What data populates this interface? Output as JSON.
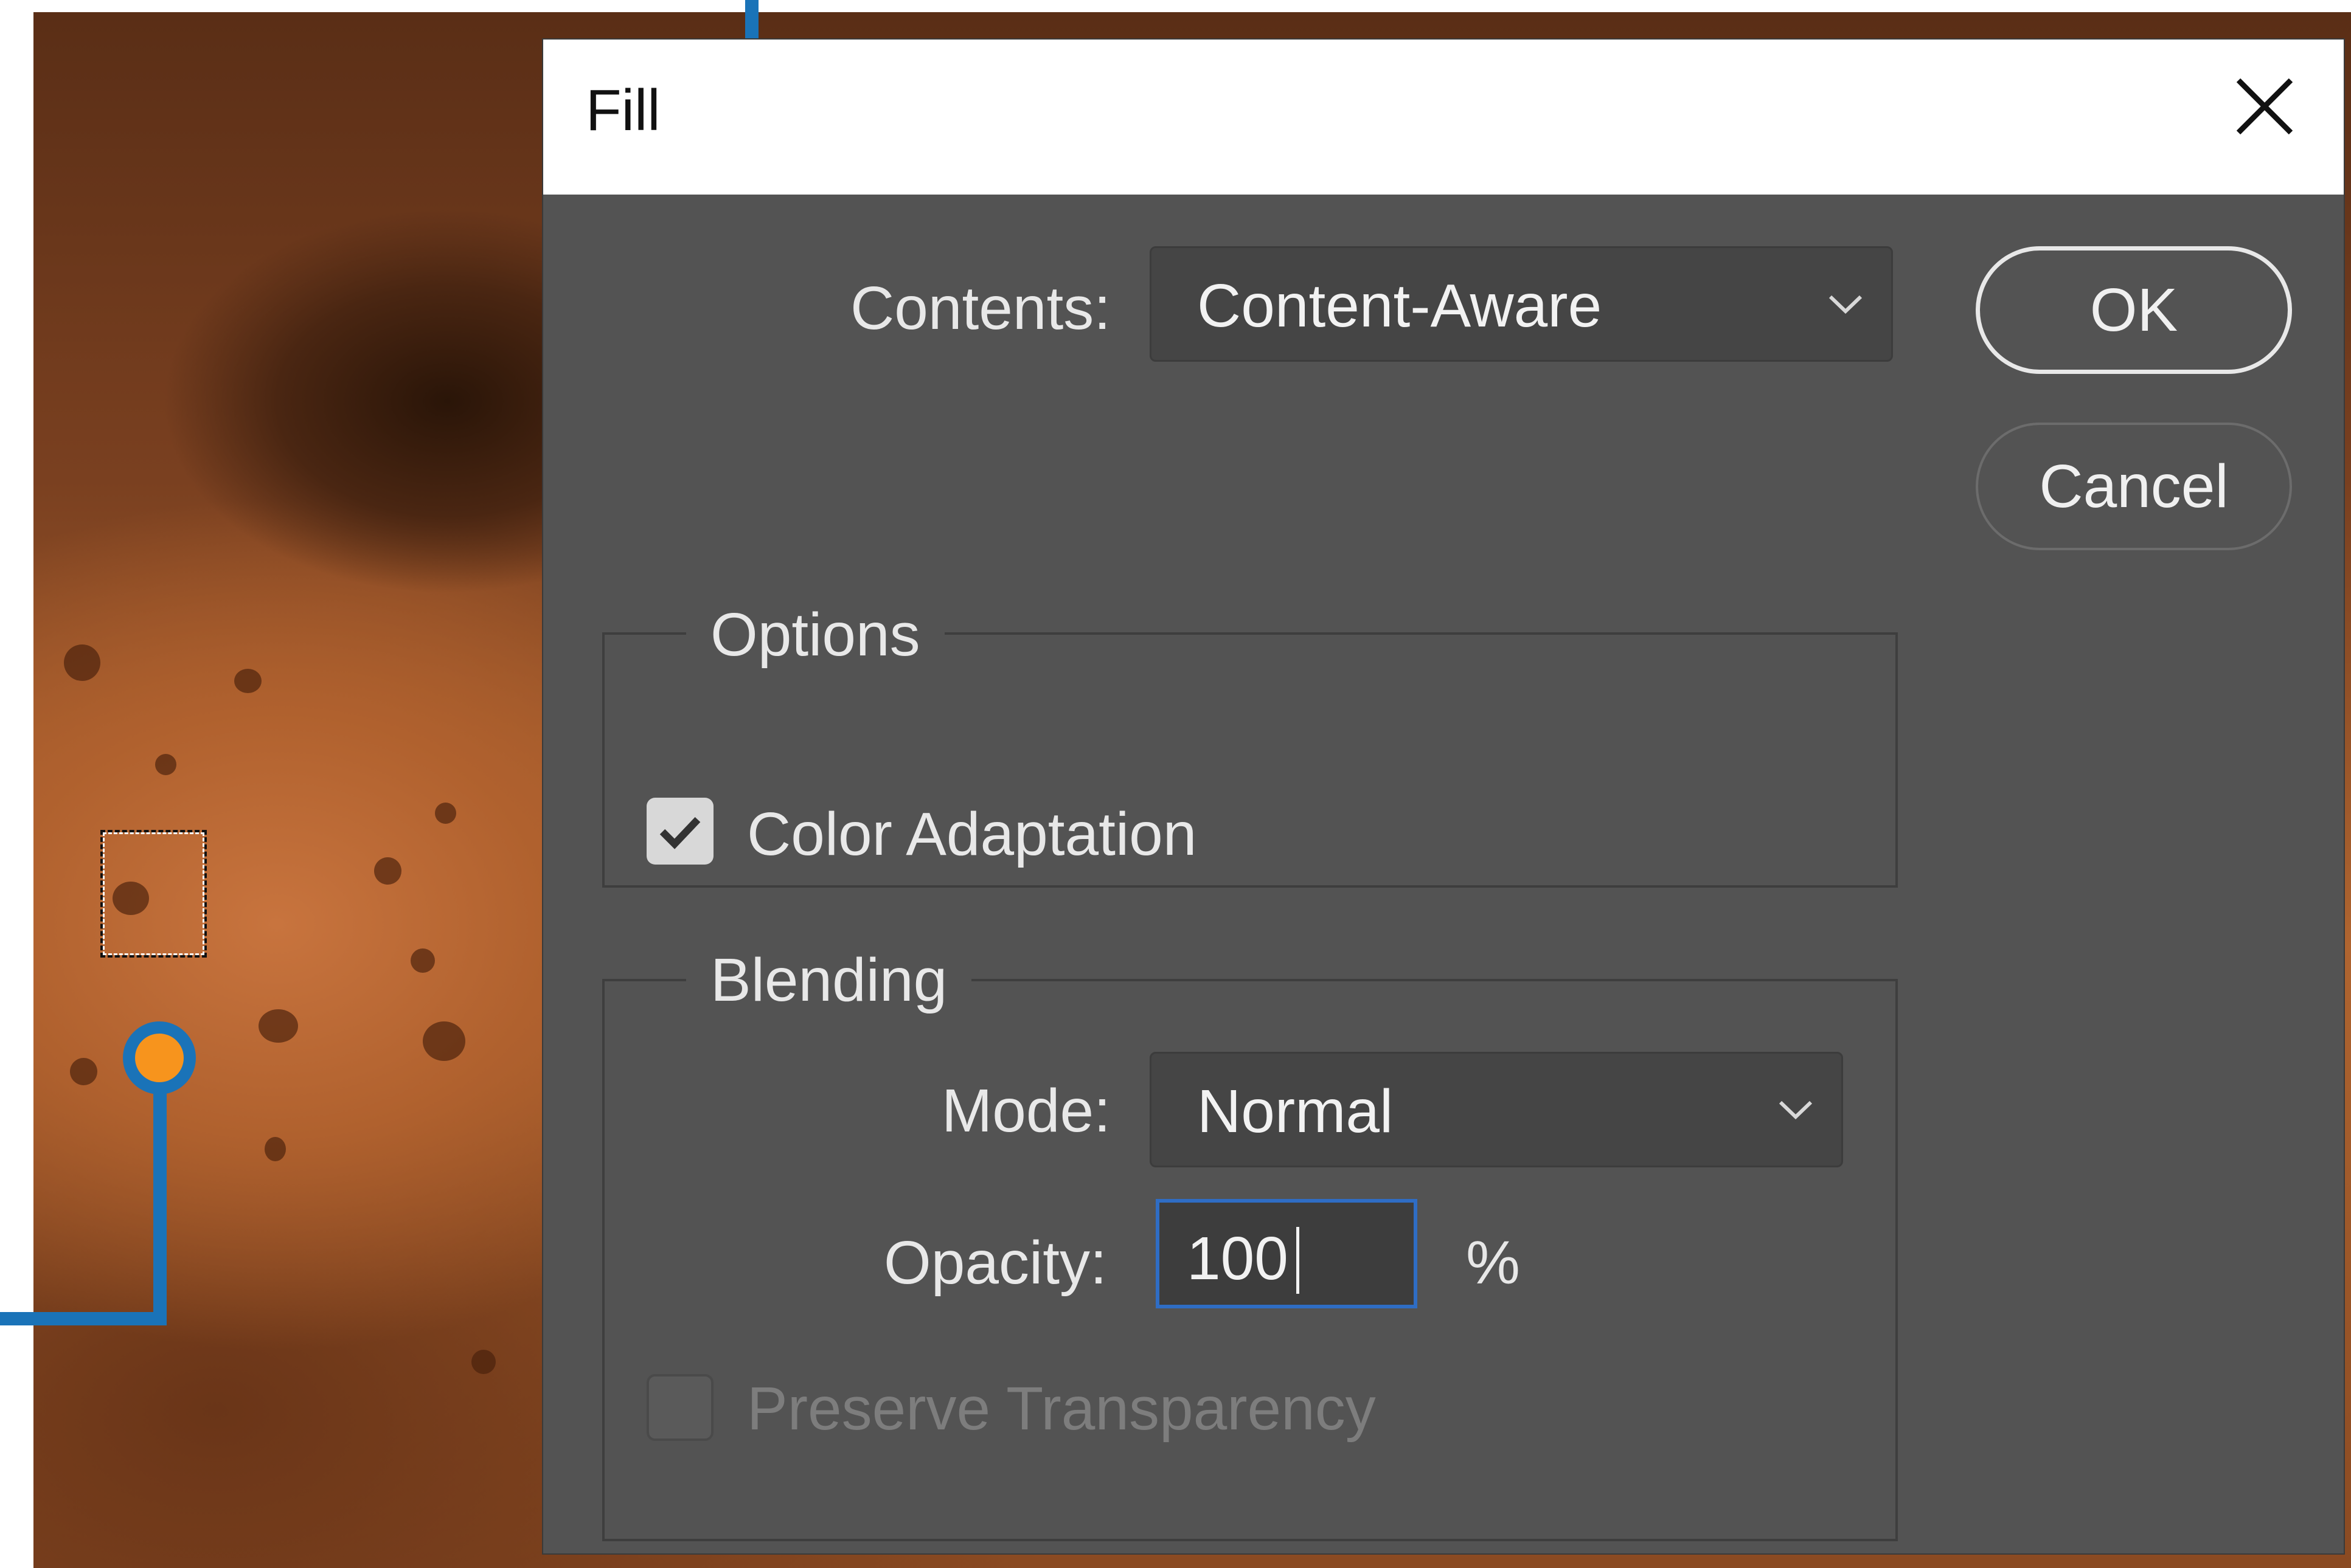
{
  "dialog": {
    "title": "Fill",
    "contents_label": "Contents:",
    "contents_value": "Content-Aware",
    "ok_label": "OK",
    "cancel_label": "Cancel",
    "options": {
      "group_label": "Options",
      "color_adaptation_label": "Color Adaptation",
      "color_adaptation_checked": true
    },
    "blending": {
      "group_label": "Blending",
      "mode_label": "Mode:",
      "mode_value": "Normal",
      "opacity_label": "Opacity:",
      "opacity_value": "100",
      "opacity_unit": "%",
      "preserve_transparency_label": "Preserve Transparency",
      "preserve_transparency_checked": false
    }
  },
  "icons": {
    "close": "close-icon",
    "dropdown": "chevron-down-icon",
    "check": "checkmark-icon"
  },
  "colors": {
    "dialog_bg": "#535353",
    "titlebar_bg": "#ffffff",
    "callout_line": "#1a73b8",
    "callout_dot": "#f7941d",
    "focus_border": "#2f6dc4"
  }
}
